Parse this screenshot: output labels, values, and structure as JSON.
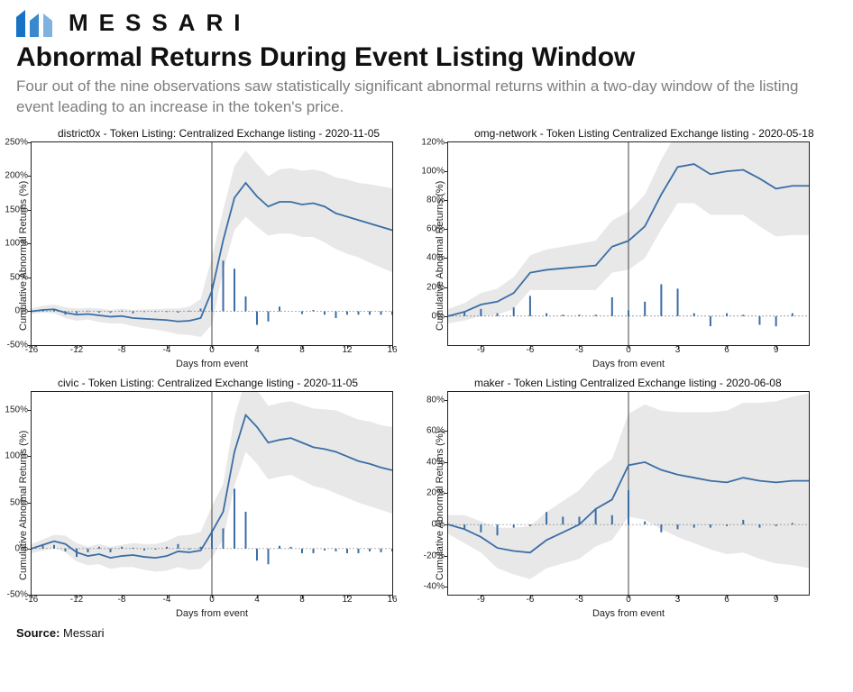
{
  "brand": "MESSARI",
  "title": "Abnormal Returns During Event Listing Window",
  "subtitle": "Four out of the nine observations saw statistically significant abnormal returns within a two-day window of the listing event leading to an increase in the token's price.",
  "source_label": "Source:",
  "source_value": "Messari",
  "axis_ylabel": "Cumulative Abnormal Returns (%)",
  "axis_xlabel": "Days from event",
  "chart_data": [
    {
      "id": "district0x",
      "title": "district0x - Token Listing: Centralized Exchange listing - 2020-11-05",
      "xlim": [
        -16,
        16
      ],
      "ylim": [
        -50,
        250
      ],
      "xticks": [
        -16,
        -12,
        -8,
        -4,
        0,
        4,
        8,
        12,
        16
      ],
      "yticks": [
        -50,
        0,
        50,
        100,
        150,
        200,
        250
      ],
      "x": [
        -16,
        -15,
        -14,
        -13,
        -12,
        -11,
        -10,
        -9,
        -8,
        -7,
        -6,
        -5,
        -4,
        -3,
        -2,
        -1,
        0,
        1,
        2,
        3,
        4,
        5,
        6,
        7,
        8,
        9,
        10,
        11,
        12,
        13,
        14,
        15,
        16
      ],
      "car": [
        0,
        2,
        3,
        -2,
        -5,
        -4,
        -6,
        -8,
        -7,
        -10,
        -11,
        -12,
        -13,
        -15,
        -14,
        -10,
        30,
        105,
        168,
        190,
        170,
        155,
        162,
        162,
        158,
        160,
        155,
        145,
        140,
        135,
        130,
        125,
        120
      ],
      "lo": [
        -4,
        -2,
        -3,
        -10,
        -14,
        -12,
        -16,
        -18,
        -18,
        -22,
        -25,
        -27,
        -30,
        -34,
        -35,
        -38,
        -20,
        60,
        120,
        140,
        125,
        112,
        115,
        115,
        110,
        110,
        102,
        92,
        85,
        80,
        72,
        65,
        58
      ],
      "hi": [
        4,
        8,
        10,
        6,
        4,
        5,
        4,
        2,
        4,
        2,
        3,
        3,
        4,
        4,
        7,
        18,
        80,
        150,
        215,
        238,
        218,
        200,
        210,
        212,
        208,
        210,
        206,
        198,
        195,
        190,
        188,
        185,
        182
      ],
      "ar": [
        0,
        3,
        2,
        -5,
        -3,
        1,
        -2,
        -2,
        1,
        -3,
        -1,
        -1,
        -1,
        -2,
        1,
        4,
        40,
        75,
        63,
        22,
        -20,
        -15,
        7,
        0,
        -4,
        2,
        -5,
        -10,
        -5,
        -5,
        -5,
        -5,
        -5
      ]
    },
    {
      "id": "omg",
      "title": "omg-network - Token Listing Centralized Exchange listing - 2020-05-18",
      "xlim": [
        -11,
        11
      ],
      "ylim": [
        -20,
        120
      ],
      "xticks": [
        -9,
        -6,
        -3,
        0,
        3,
        6,
        9
      ],
      "yticks": [
        0,
        20,
        40,
        60,
        80,
        100,
        120
      ],
      "x": [
        -11,
        -10,
        -9,
        -8,
        -7,
        -6,
        -5,
        -4,
        -3,
        -2,
        -1,
        0,
        1,
        2,
        3,
        4,
        5,
        6,
        7,
        8,
        9,
        10,
        11
      ],
      "car": [
        0,
        3,
        8,
        10,
        16,
        30,
        32,
        33,
        34,
        35,
        48,
        52,
        62,
        84,
        103,
        105,
        98,
        100,
        101,
        95,
        88,
        90,
        90
      ],
      "lo": [
        -5,
        -3,
        0,
        1,
        5,
        18,
        18,
        18,
        18,
        18,
        30,
        32,
        40,
        60,
        78,
        78,
        70,
        70,
        70,
        62,
        55,
        56,
        56
      ],
      "hi": [
        5,
        9,
        16,
        19,
        27,
        42,
        46,
        48,
        50,
        52,
        66,
        72,
        84,
        108,
        128,
        132,
        126,
        130,
        132,
        128,
        121,
        124,
        124
      ],
      "ar": [
        0,
        3,
        5,
        2,
        6,
        14,
        2,
        1,
        1,
        1,
        13,
        4,
        10,
        22,
        19,
        2,
        -7,
        2,
        1,
        -6,
        -7,
        2,
        0
      ]
    },
    {
      "id": "civic",
      "title": "civic - Token Listing: Centralized Exchange listing - 2020-11-05",
      "xlim": [
        -16,
        16
      ],
      "ylim": [
        -50,
        170
      ],
      "xticks": [
        -16,
        -12,
        -8,
        -4,
        0,
        4,
        8,
        12,
        16
      ],
      "yticks": [
        -50,
        0,
        50,
        100,
        150
      ],
      "x": [
        -16,
        -15,
        -14,
        -13,
        -12,
        -11,
        -10,
        -9,
        -8,
        -7,
        -6,
        -5,
        -4,
        -3,
        -2,
        -1,
        0,
        1,
        2,
        3,
        4,
        5,
        6,
        7,
        8,
        9,
        10,
        11,
        12,
        13,
        14,
        15,
        16
      ],
      "car": [
        0,
        4,
        8,
        5,
        -4,
        -8,
        -6,
        -10,
        -8,
        -7,
        -9,
        -10,
        -8,
        -3,
        -4,
        -2,
        18,
        40,
        105,
        145,
        132,
        115,
        118,
        120,
        115,
        110,
        108,
        105,
        100,
        95,
        92,
        88,
        85
      ],
      "lo": [
        -5,
        -2,
        1,
        -4,
        -14,
        -18,
        -17,
        -22,
        -20,
        -20,
        -23,
        -25,
        -24,
        -20,
        -23,
        -22,
        -10,
        10,
        68,
        105,
        92,
        75,
        78,
        80,
        74,
        68,
        65,
        60,
        55,
        50,
        46,
        42,
        38
      ],
      "hi": [
        5,
        10,
        15,
        14,
        6,
        2,
        5,
        2,
        4,
        6,
        5,
        5,
        8,
        14,
        15,
        18,
        46,
        70,
        142,
        185,
        172,
        155,
        158,
        160,
        156,
        152,
        151,
        150,
        145,
        140,
        138,
        134,
        132
      ],
      "ar": [
        0,
        4,
        4,
        -3,
        -9,
        -4,
        2,
        -4,
        2,
        1,
        -2,
        -1,
        2,
        5,
        -1,
        2,
        20,
        22,
        65,
        40,
        -13,
        -17,
        3,
        2,
        -5,
        -5,
        -2,
        -3,
        -5,
        -5,
        -3,
        -4,
        -3
      ]
    },
    {
      "id": "maker",
      "title": "maker - Token Listing Centralized Exchange listing - 2020-06-08",
      "xlim": [
        -11,
        11
      ],
      "ylim": [
        -45,
        85
      ],
      "xticks": [
        -9,
        -6,
        -3,
        0,
        3,
        6,
        9
      ],
      "yticks": [
        -40,
        -20,
        0,
        20,
        40,
        60,
        80
      ],
      "x": [
        -11,
        -10,
        -9,
        -8,
        -7,
        -6,
        -5,
        -4,
        -3,
        -2,
        -1,
        0,
        1,
        2,
        3,
        4,
        5,
        6,
        7,
        8,
        9,
        10,
        11
      ],
      "car": [
        0,
        -3,
        -8,
        -15,
        -17,
        -18,
        -10,
        -5,
        0,
        10,
        16,
        38,
        40,
        35,
        32,
        30,
        28,
        27,
        30,
        28,
        27,
        28,
        28
      ],
      "lo": [
        -6,
        -12,
        -18,
        -28,
        -32,
        -35,
        -28,
        -25,
        -22,
        -14,
        -10,
        5,
        3,
        -3,
        -8,
        -12,
        -16,
        -19,
        -18,
        -22,
        -25,
        -26,
        -28
      ],
      "hi": [
        6,
        6,
        2,
        -2,
        -2,
        -1,
        8,
        15,
        22,
        34,
        42,
        71,
        77,
        73,
        72,
        72,
        72,
        73,
        78,
        78,
        79,
        82,
        84
      ],
      "ar": [
        0,
        -3,
        -5,
        -7,
        -2,
        -1,
        8,
        5,
        5,
        10,
        6,
        22,
        2,
        -5,
        -3,
        -2,
        -2,
        -1,
        3,
        -2,
        -1,
        1,
        0
      ]
    }
  ]
}
